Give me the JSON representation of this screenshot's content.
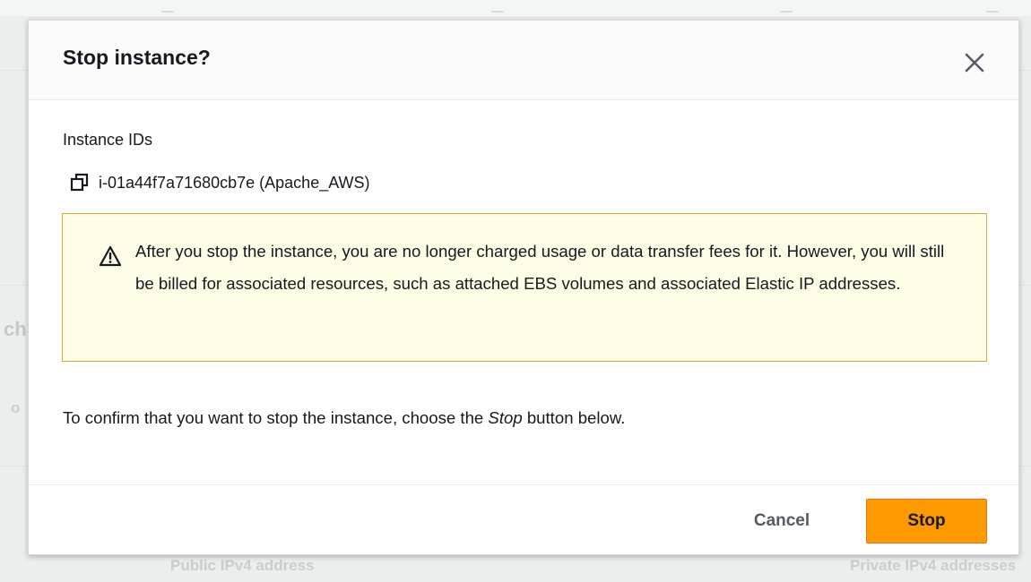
{
  "background": {
    "fragment_left": "ch",
    "fragment_left_small": "o",
    "fragment_bottom_1": "Public IPv4 address",
    "fragment_bottom_2": "Private IPv4 addresses"
  },
  "modal": {
    "title": "Stop instance?",
    "close_icon": "close-icon",
    "instance_ids_label": "Instance IDs",
    "copy_icon": "copy-icon",
    "instance_id": "i-01a44f7a71680cb7e (Apache_AWS)",
    "alert": {
      "icon": "warning-icon",
      "text": "After you stop the instance, you are no longer charged usage or data transfer fees for it. However, you will still be billed for associated resources, such as attached EBS volumes and associated Elastic IP addresses."
    },
    "confirm": {
      "before": "To confirm that you want to stop the instance, choose the ",
      "emphasis": "Stop",
      "after": " button below."
    },
    "cancel_label": "Cancel",
    "stop_label": "Stop"
  },
  "colors": {
    "primary_button": "#ff9900",
    "alert_background": "#fffce6",
    "alert_border": "#d9a93a",
    "text": "#16191f",
    "secondary_text": "#545b64"
  }
}
